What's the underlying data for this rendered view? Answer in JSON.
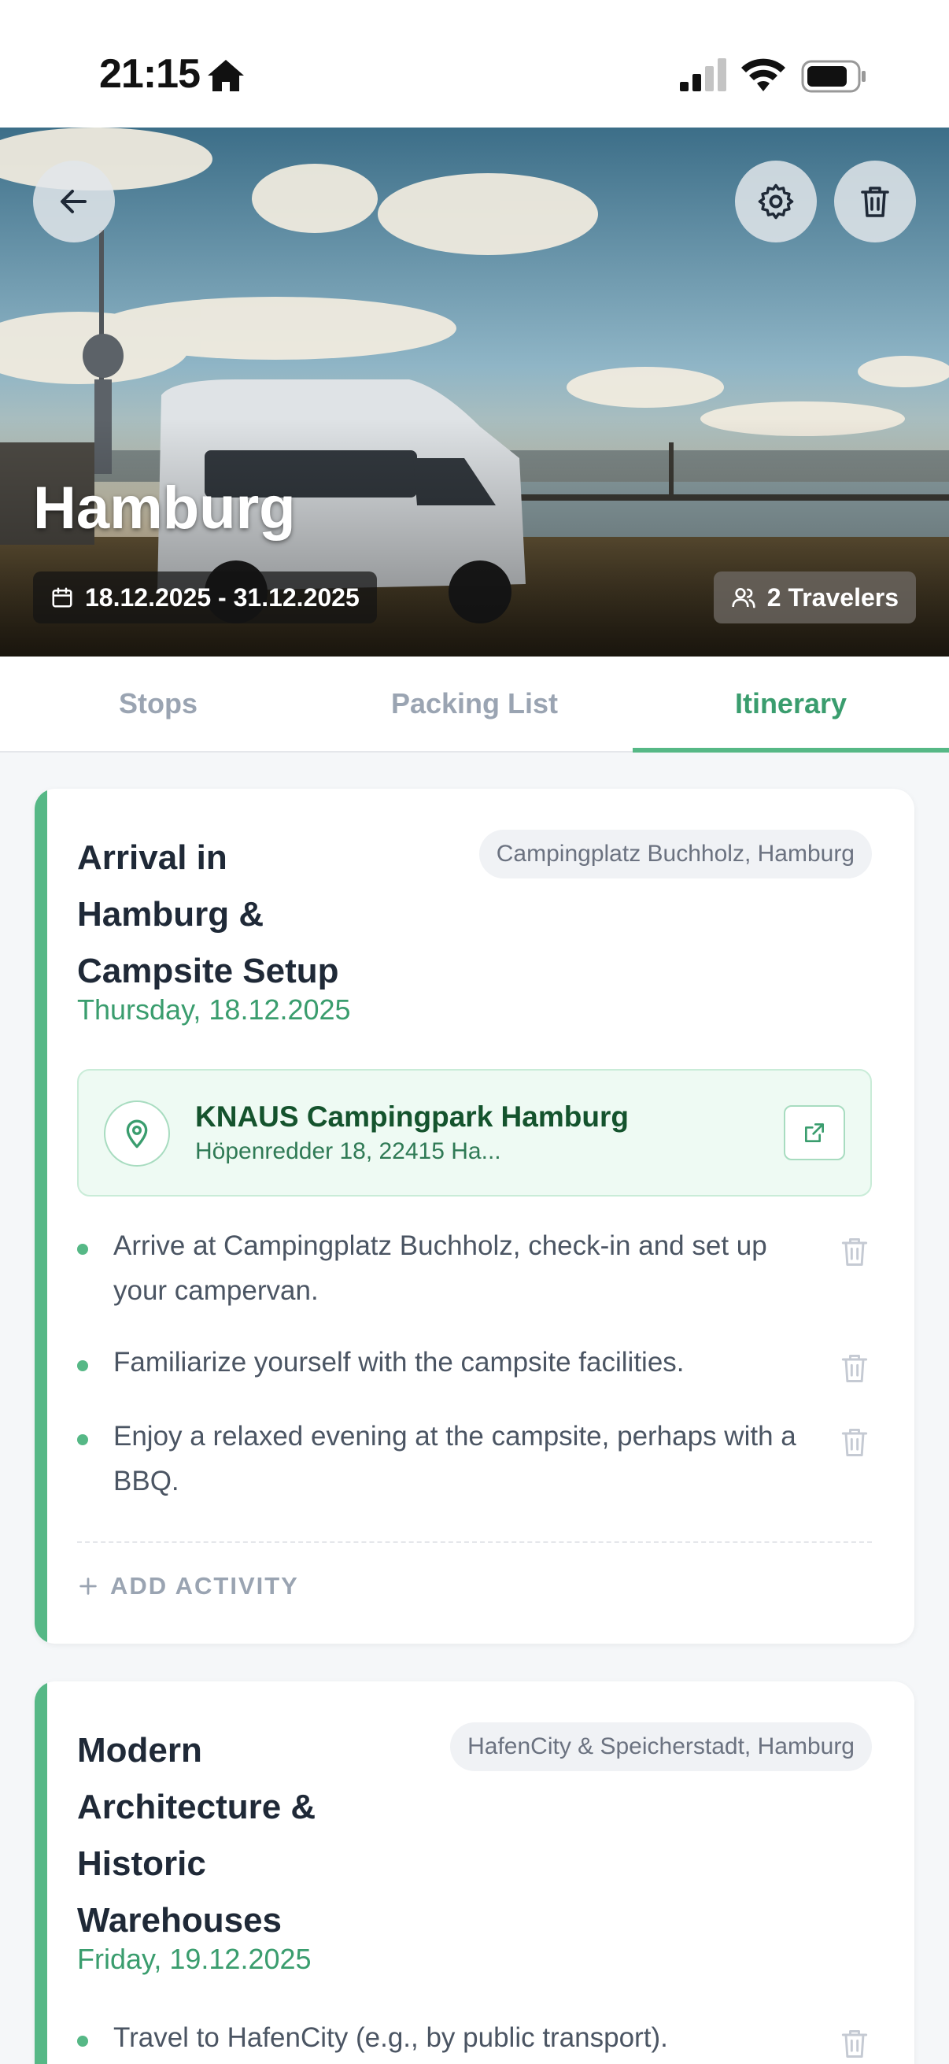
{
  "status_bar": {
    "time": "21:15"
  },
  "hero": {
    "title": "Hamburg",
    "date_range": "18.12.2025 - 31.12.2025",
    "travelers": "2 Travelers"
  },
  "tabs": [
    {
      "label": "Stops",
      "active": false
    },
    {
      "label": "Packing List",
      "active": false
    },
    {
      "label": "Itinerary",
      "active": true
    }
  ],
  "days": [
    {
      "title_lines": [
        "Arrival in",
        "Hamburg &",
        "Campsite Setup"
      ],
      "location": "Campingplatz Buchholz, Hamburg",
      "date": "Thursday, 18.12.2025",
      "place": {
        "name": "KNAUS Campingpark Hamburg",
        "address": "Höpenredder 18, 22415 Ha..."
      },
      "activities": [
        "Arrive at Campingplatz Buchholz, check-in and set up your campervan.",
        "Familiarize yourself with the campsite facilities.",
        "Enjoy a relaxed evening at the campsite, perhaps with a BBQ."
      ],
      "add_label": "ADD ACTIVITY"
    },
    {
      "title_lines": [
        "Modern",
        "Architecture &",
        "Historic",
        "Warehouses"
      ],
      "location": "HafenCity & Speicherstadt, Hamburg",
      "date": "Friday, 19.12.2025",
      "activities": [
        "Travel to HafenCity (e.g., by public transport)."
      ]
    }
  ],
  "colors": {
    "accent": "#56b886",
    "accent_text": "#3a9d6e",
    "place_bg": "#eefaf3"
  }
}
